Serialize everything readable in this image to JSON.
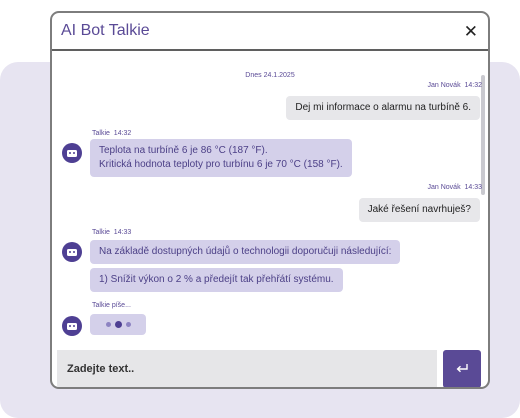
{
  "window": {
    "title": "AI Bot Talkie",
    "close_icon": "close-icon"
  },
  "chat": {
    "date": "Dnes 24.1.2025",
    "messages": [
      {
        "sender": "Jan Novák",
        "time": "14:32",
        "text": "Dej mi informace o alarmu na turbíně 6."
      },
      {
        "sender": "Talkie",
        "time": "14:32",
        "lines": [
          "Teplota na turbíně 6 je 86 °C (187 °F).",
          "Kritická hodnota teploty pro turbínu 6 je 70 °C (158 °F)."
        ]
      },
      {
        "sender": "Jan Novák",
        "time": "14:33",
        "text": "Jaké řešení navrhuješ?"
      },
      {
        "sender": "Talkie",
        "time": "14:33",
        "text": "Na základě dostupných údajů o technologii doporučuji následující:"
      },
      {
        "text": "1)    Snížit výkon o 2 % a předejít tak přehřátí systému."
      }
    ],
    "typing_status": "Talkie píše..."
  },
  "composer": {
    "placeholder": "Zadejte text..",
    "send_icon": "enter-arrow-icon"
  },
  "colors": {
    "accent": "#5a4a96",
    "bot_bubble": "#d4d0ea",
    "user_bubble": "#e7e7ea",
    "backdrop": "#e7e4f1"
  }
}
